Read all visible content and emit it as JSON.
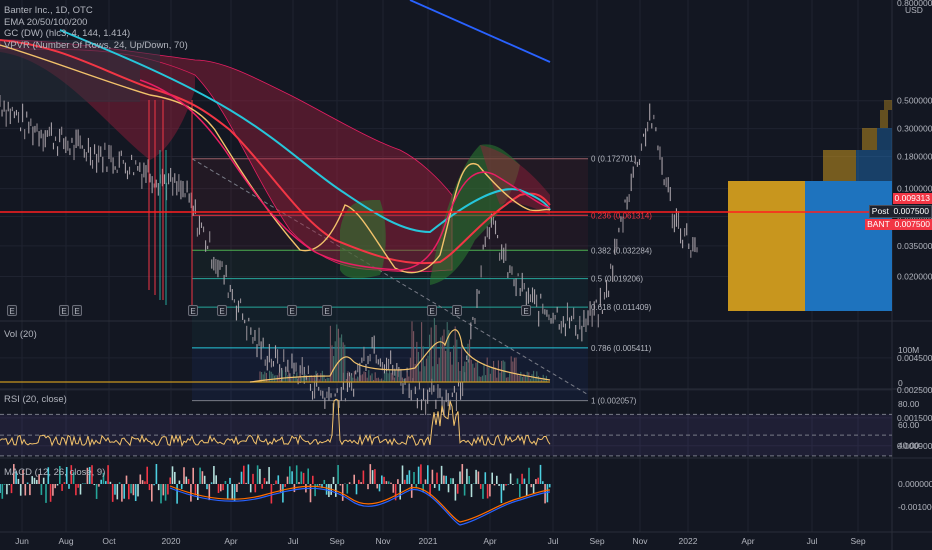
{
  "legend": {
    "line1": "Banter Inc., 1D, OTC",
    "line2": "EMA 20/50/100/200",
    "line3": "GC (DW) (hlc3, 4, 144, 1.414)",
    "line4": "VPVR (Number Of Rows, 24, Up/Down, 70)"
  },
  "price_axis": {
    "unit": "USD",
    "top_partial": "0.800000",
    "labels": [
      "0.500000",
      "0.300000",
      "0.180000",
      "0.100000",
      "0.060000",
      "0.035000",
      "0.020000",
      "0.004500",
      "0.002500",
      "0.001500",
      "0.000900"
    ]
  },
  "price_tags": {
    "tag1": "0.009313",
    "tag2_label": "Post",
    "tag2_value": "0.007500",
    "tag3_label": "BANT",
    "tag3_value": "0.007500"
  },
  "fib_levels": [
    {
      "label": "0 (0.172701)"
    },
    {
      "label": "0.236 (0.061314)"
    },
    {
      "label": "0.382 (0.032284)"
    },
    {
      "label": "0.5 (0.019206)"
    },
    {
      "label": "0.618 (0.011409)"
    },
    {
      "label": "0.786 (0.005411)"
    },
    {
      "label": "1 (0.002057)"
    }
  ],
  "earnings_marker": "E",
  "volume_pane": {
    "title": "Vol (20)",
    "ticks": [
      "100M",
      "0"
    ]
  },
  "rsi_pane": {
    "title": "RSI (20, close)",
    "ticks": [
      "80.00",
      "60.00",
      "40.00"
    ]
  },
  "macd_pane": {
    "title": "MACD (12, 26, close, 9)",
    "ticks": [
      "0.000000",
      "-0.001000"
    ]
  },
  "time_axis": [
    "Jun",
    "Aug",
    "Oct",
    "2020",
    "Apr",
    "Jul",
    "Sep",
    "Nov",
    "2021",
    "Apr",
    "Jul",
    "Sep",
    "Nov",
    "2022",
    "Apr",
    "Jul",
    "Sep"
  ],
  "colors": {
    "background": "#131722",
    "ema20": "#f2c26b",
    "ema50": "#f23645",
    "ema100": "#e91e63",
    "ema200": "#26c6da",
    "price": "#b9a6a6",
    "fib_red": "#f23645",
    "fib_teal": "#26a69a",
    "trendline": "#2962ff",
    "vpvr_up": "#c8961e",
    "vpvr_down": "#1e73be",
    "horizontal_line": "#ff1f1f"
  },
  "chart_data": {
    "type": "line",
    "series": [
      {
        "name": "Banter Inc.",
        "x": [
          "2019-05",
          "2019-06",
          "2019-07",
          "2019-08",
          "2019-09",
          "2019-10",
          "2019-11",
          "2019-12",
          "2020-01",
          "2020-02",
          "2020-03",
          "2020-04",
          "2020-05",
          "2020-06",
          "2020-07",
          "2020-08",
          "2020-09",
          "2020-10",
          "2020-11",
          "2020-12",
          "2021-01",
          "2021-02",
          "2021-03",
          "2021-04",
          "2021-05",
          "2021-06",
          "2021-07",
          "2021-08",
          "2021-09",
          "2021-10",
          "2021-11"
        ],
        "values": [
          0.5,
          0.33,
          0.28,
          0.22,
          0.2,
          0.17,
          0.15,
          0.12,
          0.09,
          0.035,
          0.015,
          0.006,
          0.004,
          0.0035,
          0.0022,
          0.0025,
          0.006,
          0.0035,
          0.0025,
          0.002,
          0.003,
          0.06,
          0.02,
          0.012,
          0.01,
          0.008,
          0.012,
          0.09,
          0.4,
          0.06,
          0.03
        ]
      }
    ],
    "fib_retracement": [
      0.172701,
      0.061314,
      0.032284,
      0.019206,
      0.011409,
      0.005411,
      0.002057
    ],
    "current_price": 0.0075,
    "volume_peak_approx": 120000000,
    "rsi_range": [
      30,
      90
    ],
    "y_scale": "log"
  }
}
